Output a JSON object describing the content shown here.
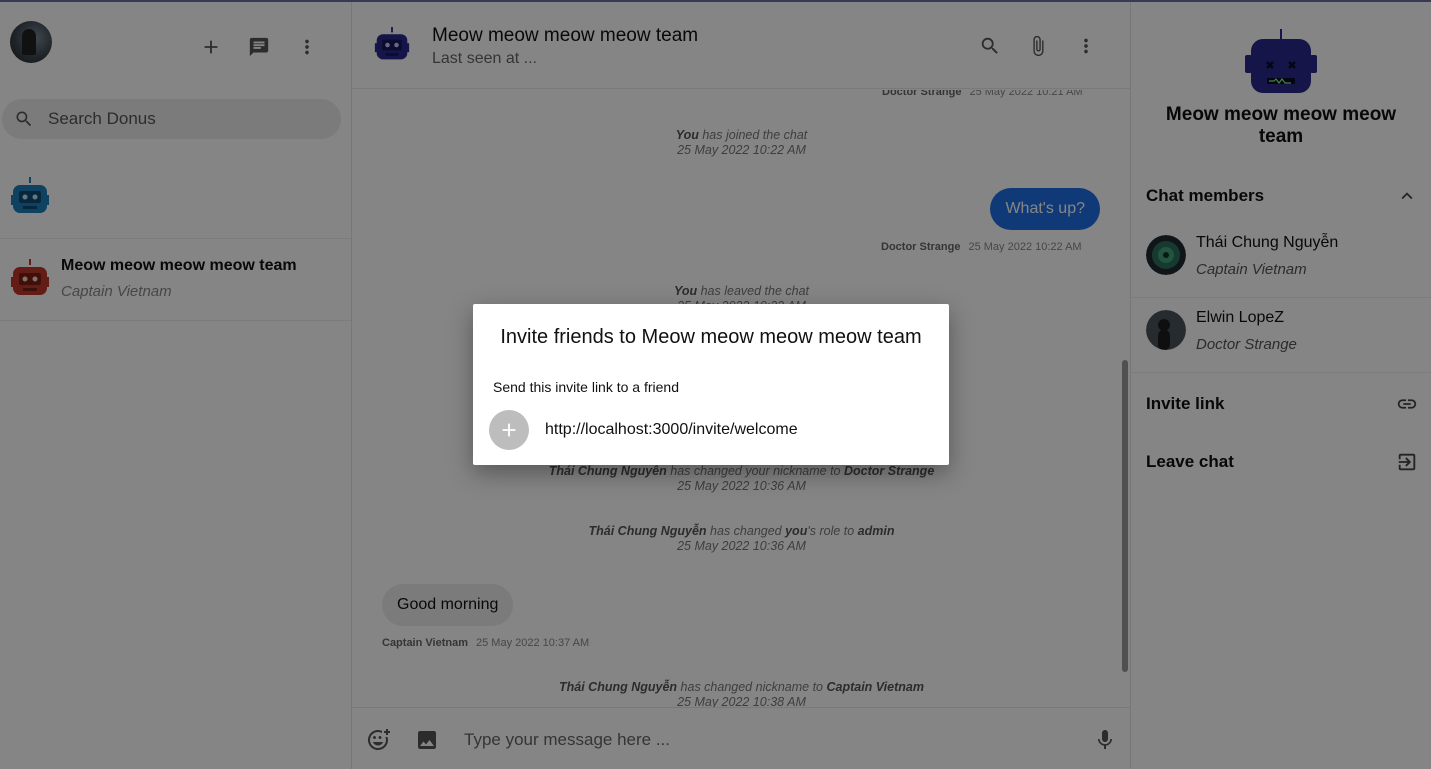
{
  "sidebar": {
    "search_placeholder": "Search Donus",
    "conversations": [
      {
        "name": "",
        "subtitle": ""
      },
      {
        "name": "Meow meow meow meow team",
        "subtitle": "Captain Vietnam"
      }
    ]
  },
  "chat": {
    "title": "Meow meow meow meow team",
    "status": "Last seen at ...",
    "messages": {
      "top_meta": {
        "sender": "Doctor Strange",
        "time": "25 May 2022 10:21 AM"
      },
      "joined": {
        "actor": "You",
        "text": " has joined the chat",
        "time": "25 May 2022 10:22 AM"
      },
      "whats_up": {
        "text": "What's up?",
        "sender": "Doctor Strange",
        "time": "25 May 2022 10:22 AM"
      },
      "leaved": {
        "actor": "You",
        "text": " has leaved the chat",
        "time": "25 May 2022 10:22 AM"
      },
      "nickname1": {
        "actor": "Thái Chung Nguyễn",
        "text": " has changed your nickname to ",
        "target": "Doctor Strange",
        "time": "25 May 2022 10:36 AM"
      },
      "role": {
        "actor": "Thái Chung Nguyễn",
        "text1": " has changed ",
        "you": "you",
        "text2": "'s role to ",
        "role": "admin",
        "time": "25 May 2022 10:36 AM"
      },
      "good_morning": {
        "text": "Good morning",
        "sender": "Captain Vietnam",
        "time": "25 May 2022 10:37 AM"
      },
      "nickname2": {
        "actor": "Thái Chung Nguyễn",
        "text": " has changed nickname to ",
        "target": "Captain Vietnam",
        "time": "25 May 2022 10:38 AM"
      }
    },
    "composer_placeholder": "Type your message here ..."
  },
  "info": {
    "title": "Meow meow meow meow team",
    "members_label": "Chat members",
    "members": [
      {
        "name": "Thái Chung Nguyễn",
        "nickname": "Captain Vietnam"
      },
      {
        "name": "Elwin LopeZ",
        "nickname": "Doctor Strange"
      }
    ],
    "invite_label": "Invite link",
    "leave_label": "Leave chat"
  },
  "modal": {
    "title": "Invite friends to Meow meow meow meow team",
    "subtitle": "Send this invite link to a friend",
    "link": "http://localhost:3000/invite/welcome"
  },
  "colors": {
    "accent": "#1f6fe5",
    "bot_blue": "#2a2a8c",
    "bot_red": "#c0392b",
    "bot_cyan": "#1e7fb8"
  }
}
